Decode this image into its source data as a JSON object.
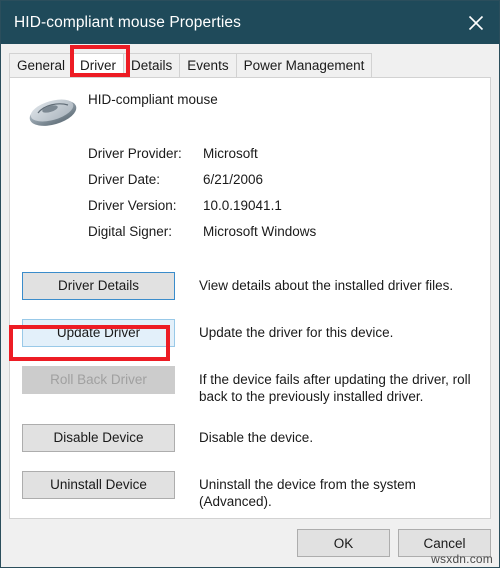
{
  "window": {
    "title": "HID-compliant mouse Properties",
    "close_icon": "close-icon"
  },
  "tabs": [
    {
      "label": "General",
      "active": false
    },
    {
      "label": "Driver",
      "active": true
    },
    {
      "label": "Details",
      "active": false
    },
    {
      "label": "Events",
      "active": false
    },
    {
      "label": "Power Management",
      "active": false
    }
  ],
  "device": {
    "name": "HID-compliant mouse",
    "icon": "mouse-icon"
  },
  "driver_info": [
    {
      "label": "Driver Provider:",
      "value": "Microsoft"
    },
    {
      "label": "Driver Date:",
      "value": "6/21/2006"
    },
    {
      "label": "Driver Version:",
      "value": "10.0.19041.1"
    },
    {
      "label": "Digital Signer:",
      "value": "Microsoft Windows"
    }
  ],
  "actions": [
    {
      "label": "Driver Details",
      "description": "View details about the installed driver files.",
      "state": "focused"
    },
    {
      "label": "Update Driver",
      "description": "Update the driver for this device.",
      "state": "hovered"
    },
    {
      "label": "Roll Back Driver",
      "description": "If the device fails after updating the driver, roll back to the previously installed driver.",
      "state": "disabled"
    },
    {
      "label": "Disable Device",
      "description": "Disable the device.",
      "state": "normal"
    },
    {
      "label": "Uninstall Device",
      "description": "Uninstall the device from the system (Advanced).",
      "state": "normal"
    }
  ],
  "footer": {
    "ok_label": "OK",
    "cancel_label": "Cancel"
  },
  "watermark": "wsxdn.com",
  "colors": {
    "titlebar": "#1f4a5a",
    "highlight": "#ed1c24",
    "focus_border": "#3a8ccb",
    "hover_fill": "#e3f0fa",
    "button_face": "#e1e1e1"
  }
}
